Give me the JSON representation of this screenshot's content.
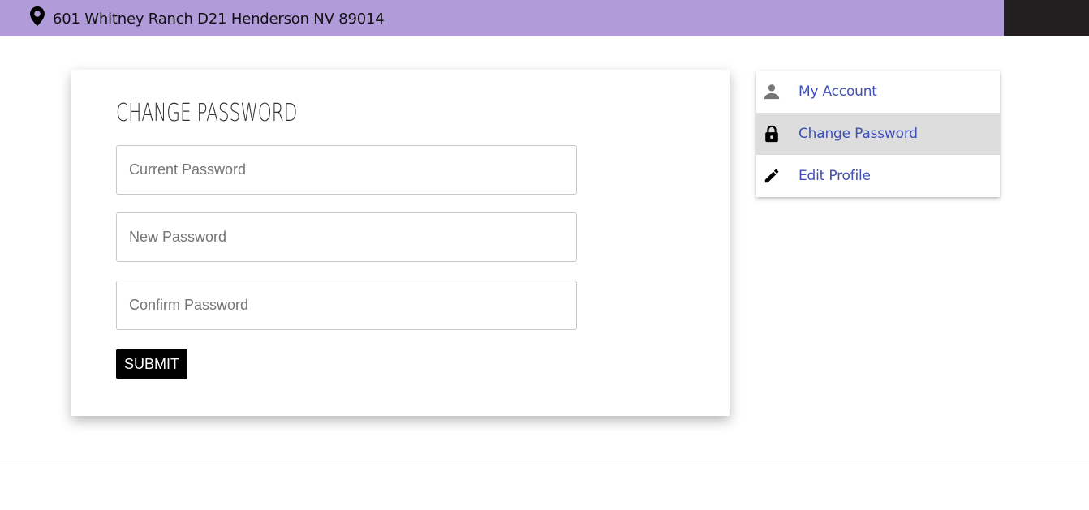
{
  "header": {
    "address": "601 Whitney Ranch D21 Henderson NV 89014",
    "address_icon": "map-pin-icon",
    "bar_color": "#b19cd9",
    "dark_block_color": "#231f20"
  },
  "form": {
    "title": "Change Password",
    "current_password_placeholder": "Current Password",
    "new_password_placeholder": "New Password",
    "confirm_password_placeholder": "Confirm Password",
    "current_password_value": "",
    "new_password_value": "",
    "confirm_password_value": "",
    "submit_label": "SUBMIT"
  },
  "sidebar": {
    "items": [
      {
        "label": "My Account",
        "icon": "person-icon",
        "active": false
      },
      {
        "label": "Change Password",
        "icon": "lock-icon",
        "active": true
      },
      {
        "label": "Edit Profile",
        "icon": "pencil-icon",
        "active": false
      }
    ],
    "link_color": "#3f51b5",
    "active_background": "#dddddd"
  },
  "footer": {
    "logo_text": ""
  }
}
